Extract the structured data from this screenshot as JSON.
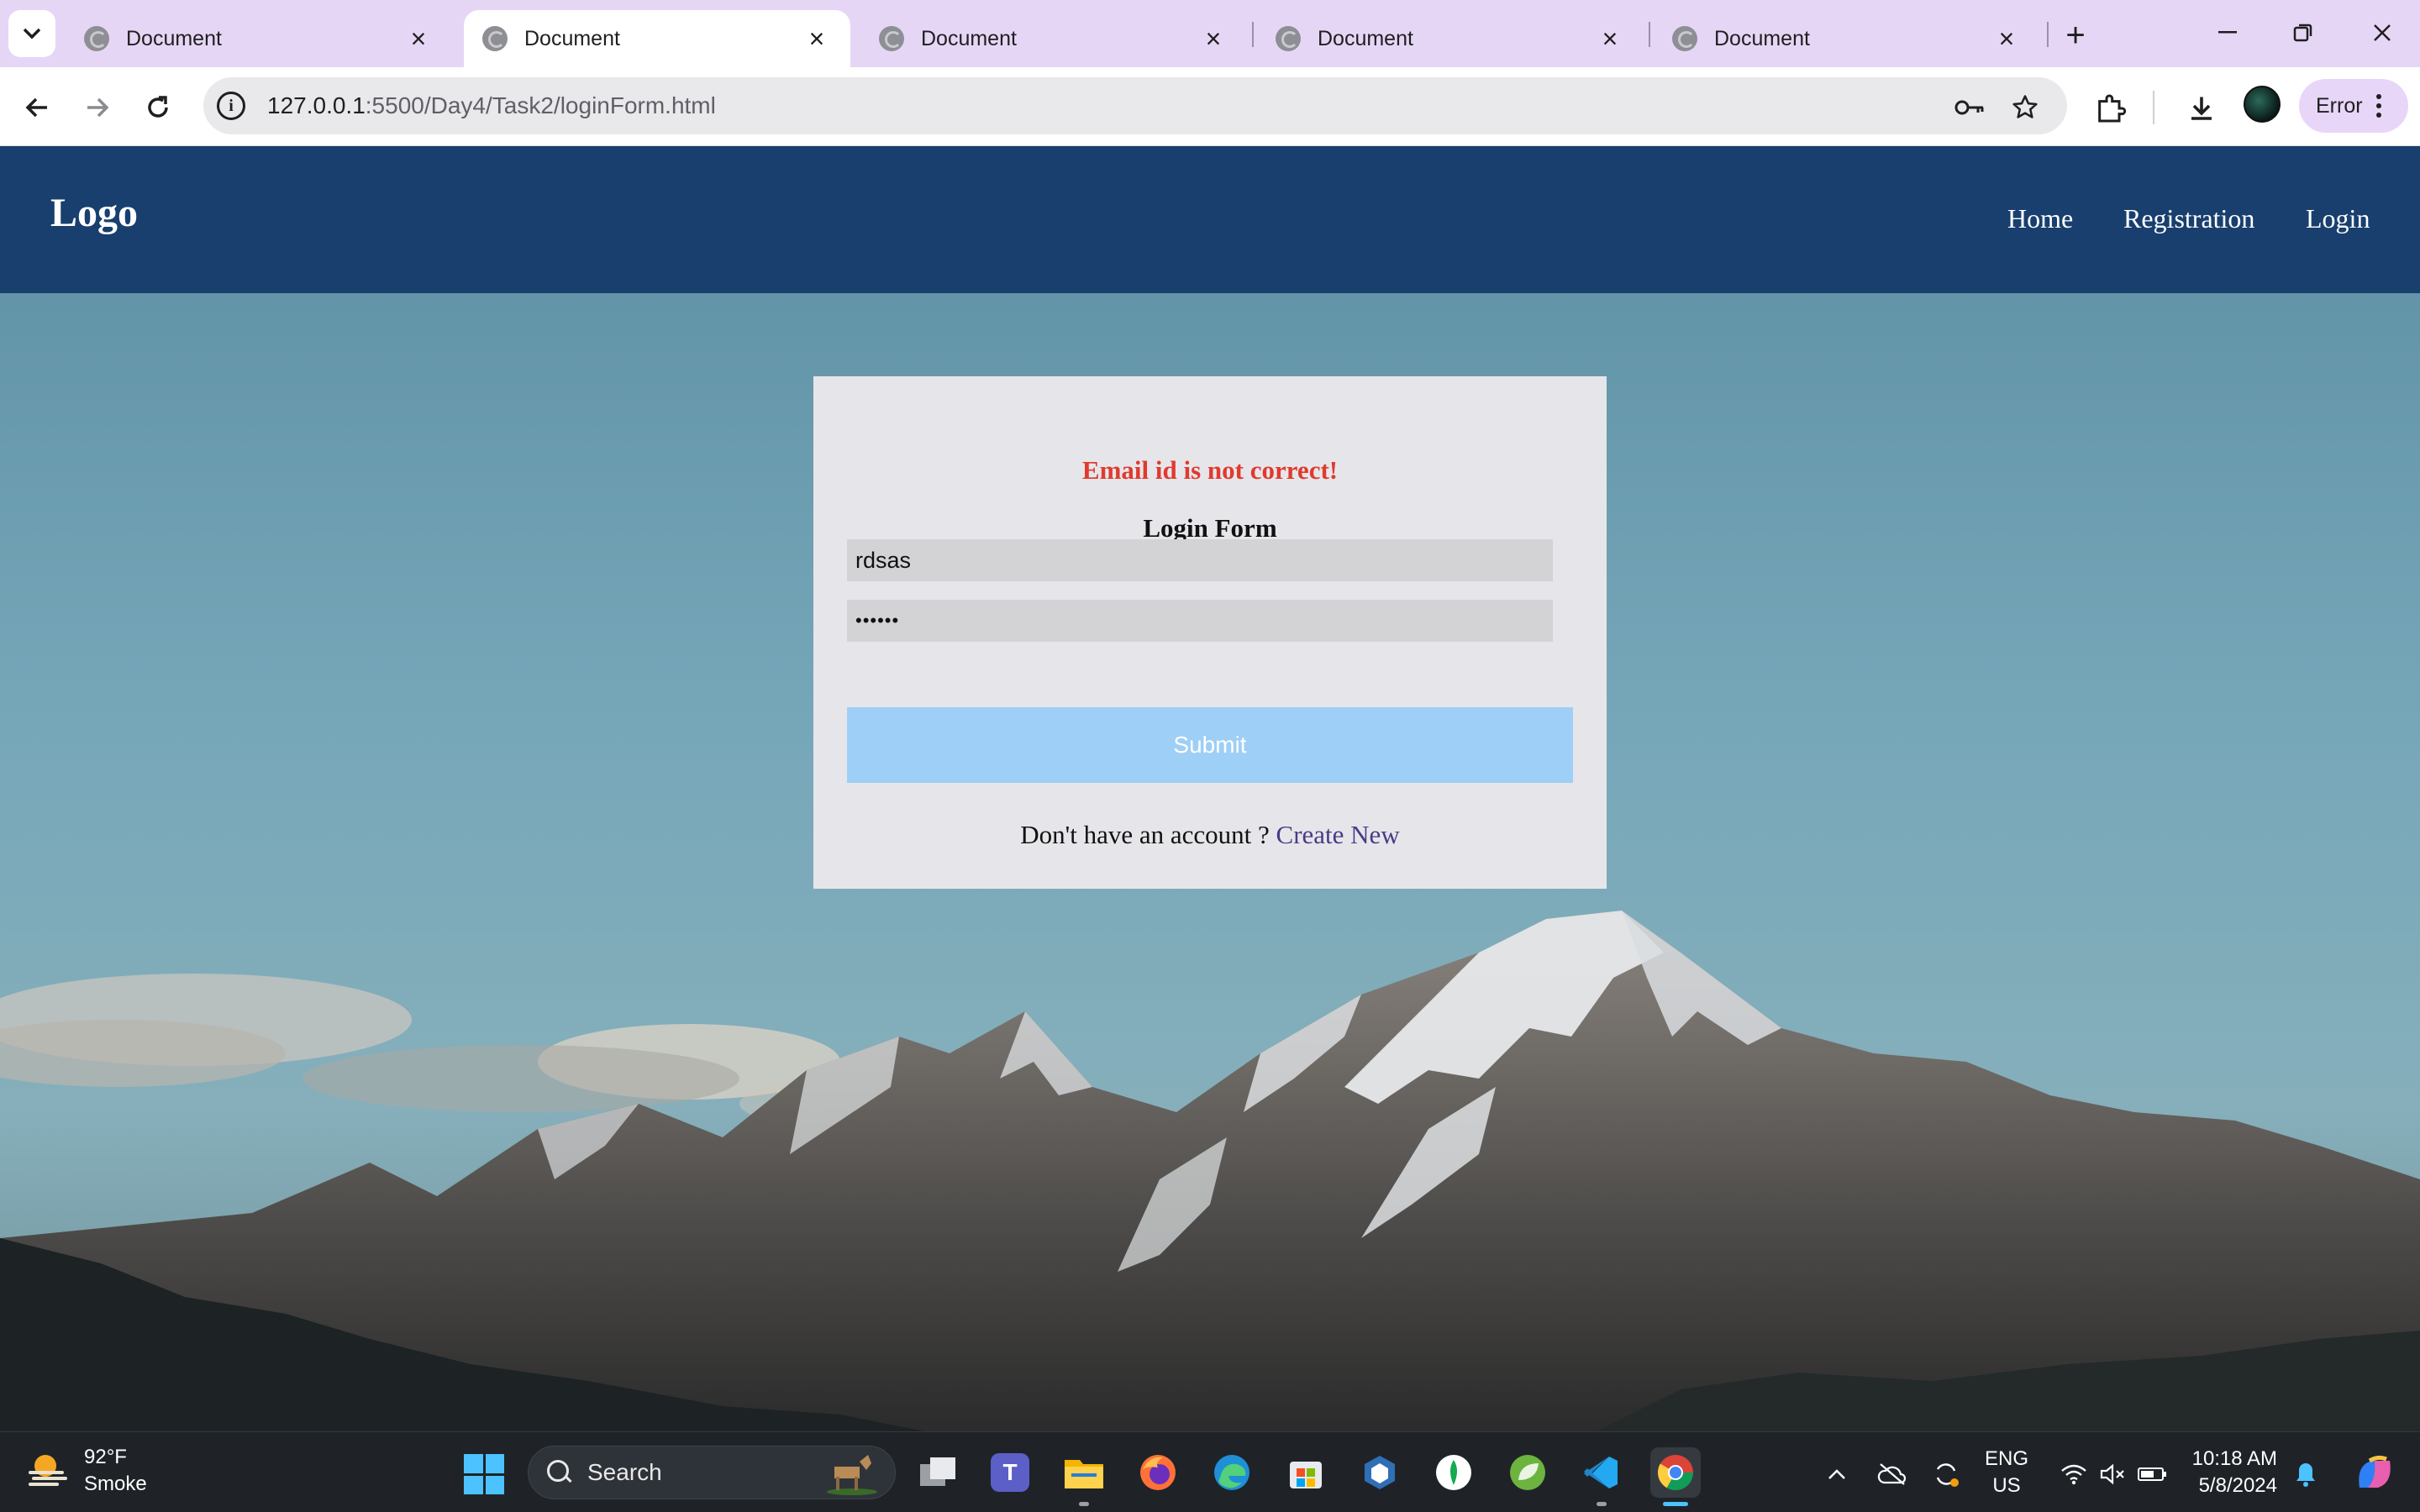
{
  "browser": {
    "tabs": [
      {
        "title": "Document",
        "active": false
      },
      {
        "title": "Document",
        "active": true
      },
      {
        "title": "Document",
        "active": false
      },
      {
        "title": "Document",
        "active": false
      },
      {
        "title": "Document",
        "active": false
      }
    ],
    "url_host": "127.0.0.1",
    "url_rest": ":5500/Day4/Task2/loginForm.html",
    "error_label": "Error"
  },
  "site": {
    "logo": "Logo",
    "nav": [
      "Home",
      "Registration",
      "Login"
    ]
  },
  "login_form": {
    "error_message": "Email id is not correct!",
    "title": "Login Form",
    "email_value": "rdsas",
    "password_value": "••••••",
    "submit_label": "Submit",
    "signup_prompt": "Don't have an account ? ",
    "signup_link": "Create New"
  },
  "taskbar": {
    "weather_temp": "92°F",
    "weather_desc": "Smoke",
    "search_label": "Search",
    "language_line1": "ENG",
    "language_line2": "US",
    "time": "10:18 AM",
    "date": "5/8/2024"
  },
  "colors": {
    "site_nav": "#183f6e",
    "error_text": "#e03a2e",
    "submit_bg": "#9ecff6",
    "signup_link": "#4b3a86",
    "tabstrip": "#e6d6f6"
  },
  "icons": {
    "taskbar_apps": [
      "task-view-icon",
      "teams-icon",
      "file-explorer-icon",
      "firefox-icon",
      "edge-icon",
      "microsoft-store-icon",
      "virtualbox-icon",
      "mongodb-compass-icon",
      "spring-tools-icon",
      "vscode-icon",
      "chrome-icon"
    ]
  }
}
